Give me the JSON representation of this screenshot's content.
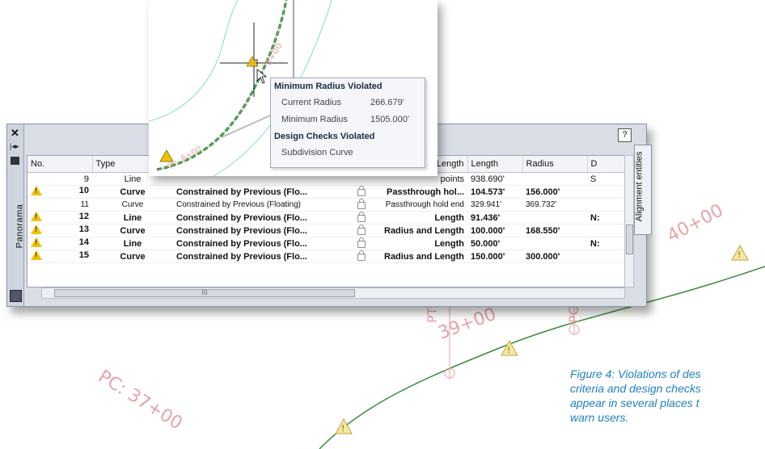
{
  "drawing": {
    "labels": [
      {
        "id": "sta40",
        "text": "40+00"
      },
      {
        "id": "sta39",
        "text": "39+00"
      },
      {
        "id": "pt",
        "text": "PT:"
      },
      {
        "id": "pc37",
        "text": "PC: 37+00"
      },
      {
        "id": "pc",
        "text": "PC"
      }
    ],
    "colors": {
      "alignment": "#3a8a3a",
      "annotation": "#e8a3a8",
      "offset": "#7fe0c0",
      "warning": "#f2c200"
    }
  },
  "inset": {
    "label": "0+00",
    "label2": "6+00",
    "label3": "PC"
  },
  "tooltip": {
    "title": "Minimum Radius Violated",
    "current_label": "Current Radius",
    "current_value": "266.679'",
    "minimum_label": "Minimum Radius",
    "minimum_value": "1505.000'",
    "checks_title": "Design Checks Violated",
    "check_item": "Subdivision Curve"
  },
  "panorama": {
    "title": "Panorama",
    "close_glyph": "✕",
    "help_label": "?",
    "side_tab": "Alignment entities",
    "columns": [
      "No.",
      "Type",
      "",
      "",
      "Constraint Length",
      "Length",
      "Radius",
      "D"
    ],
    "rows": [
      {
        "no": "9",
        "type": "Line",
        "constraint": "",
        "param": "points",
        "length": "938.690'",
        "radius": "",
        "d": "S",
        "warn": false,
        "style": "first"
      },
      {
        "no": "10",
        "type": "Curve",
        "constraint": "Constrained by Previous (Flo...",
        "param": "Passthrough hol...",
        "length": "104.573'",
        "radius": "156.000'",
        "d": "",
        "warn": true,
        "style": "bold"
      },
      {
        "no": "11",
        "type": "Curve",
        "constraint": "Constrained by Previous (Floating)",
        "param": "Passthrough hold end",
        "length": "329.941'",
        "radius": "369.732'",
        "d": "",
        "warn": false,
        "style": "plain"
      },
      {
        "no": "12",
        "type": "Line",
        "constraint": "Constrained by Previous (Flo...",
        "param": "Length",
        "length": "91.436'",
        "radius": "",
        "d": "N:",
        "warn": true,
        "style": "bold"
      },
      {
        "no": "13",
        "type": "Curve",
        "constraint": "Constrained by Previous (Flo...",
        "param": "Radius and Length",
        "length": "100.000'",
        "radius": "168.550'",
        "d": "",
        "warn": true,
        "style": "bold"
      },
      {
        "no": "14",
        "type": "Line",
        "constraint": "Constrained by Previous (Flo...",
        "param": "Length",
        "length": "50.000'",
        "radius": "",
        "d": "N:",
        "warn": true,
        "style": "bold"
      },
      {
        "no": "15",
        "type": "Curve",
        "constraint": "Constrained by Previous (Flo...",
        "param": "Radius and Length",
        "length": "150.000'",
        "radius": "300.000'",
        "d": "",
        "warn": true,
        "style": "bold"
      }
    ],
    "hscroll_grip": "III"
  },
  "caption": {
    "line1": "Figure 4: Violations of des",
    "line2": "criteria and design checks",
    "line3": "appear in several places t",
    "line4": "warn users."
  }
}
